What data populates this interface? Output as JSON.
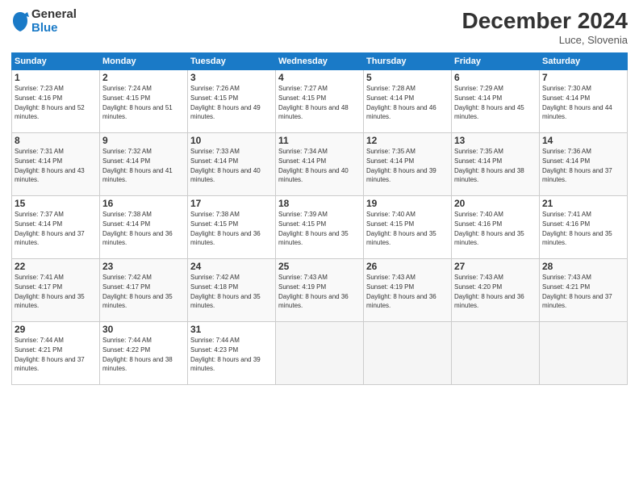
{
  "logo": {
    "general": "General",
    "blue": "Blue"
  },
  "title": "December 2024",
  "location": "Luce, Slovenia",
  "days_of_week": [
    "Sunday",
    "Monday",
    "Tuesday",
    "Wednesday",
    "Thursday",
    "Friday",
    "Saturday"
  ],
  "weeks": [
    [
      {
        "day": 1,
        "sunrise": "7:23 AM",
        "sunset": "4:16 PM",
        "daylight": "8 hours and 52 minutes."
      },
      {
        "day": 2,
        "sunrise": "7:24 AM",
        "sunset": "4:15 PM",
        "daylight": "8 hours and 51 minutes."
      },
      {
        "day": 3,
        "sunrise": "7:26 AM",
        "sunset": "4:15 PM",
        "daylight": "8 hours and 49 minutes."
      },
      {
        "day": 4,
        "sunrise": "7:27 AM",
        "sunset": "4:15 PM",
        "daylight": "8 hours and 48 minutes."
      },
      {
        "day": 5,
        "sunrise": "7:28 AM",
        "sunset": "4:14 PM",
        "daylight": "8 hours and 46 minutes."
      },
      {
        "day": 6,
        "sunrise": "7:29 AM",
        "sunset": "4:14 PM",
        "daylight": "8 hours and 45 minutes."
      },
      {
        "day": 7,
        "sunrise": "7:30 AM",
        "sunset": "4:14 PM",
        "daylight": "8 hours and 44 minutes."
      }
    ],
    [
      {
        "day": 8,
        "sunrise": "7:31 AM",
        "sunset": "4:14 PM",
        "daylight": "8 hours and 43 minutes."
      },
      {
        "day": 9,
        "sunrise": "7:32 AM",
        "sunset": "4:14 PM",
        "daylight": "8 hours and 41 minutes."
      },
      {
        "day": 10,
        "sunrise": "7:33 AM",
        "sunset": "4:14 PM",
        "daylight": "8 hours and 40 minutes."
      },
      {
        "day": 11,
        "sunrise": "7:34 AM",
        "sunset": "4:14 PM",
        "daylight": "8 hours and 40 minutes."
      },
      {
        "day": 12,
        "sunrise": "7:35 AM",
        "sunset": "4:14 PM",
        "daylight": "8 hours and 39 minutes."
      },
      {
        "day": 13,
        "sunrise": "7:35 AM",
        "sunset": "4:14 PM",
        "daylight": "8 hours and 38 minutes."
      },
      {
        "day": 14,
        "sunrise": "7:36 AM",
        "sunset": "4:14 PM",
        "daylight": "8 hours and 37 minutes."
      }
    ],
    [
      {
        "day": 15,
        "sunrise": "7:37 AM",
        "sunset": "4:14 PM",
        "daylight": "8 hours and 37 minutes."
      },
      {
        "day": 16,
        "sunrise": "7:38 AM",
        "sunset": "4:14 PM",
        "daylight": "8 hours and 36 minutes."
      },
      {
        "day": 17,
        "sunrise": "7:38 AM",
        "sunset": "4:15 PM",
        "daylight": "8 hours and 36 minutes."
      },
      {
        "day": 18,
        "sunrise": "7:39 AM",
        "sunset": "4:15 PM",
        "daylight": "8 hours and 35 minutes."
      },
      {
        "day": 19,
        "sunrise": "7:40 AM",
        "sunset": "4:15 PM",
        "daylight": "8 hours and 35 minutes."
      },
      {
        "day": 20,
        "sunrise": "7:40 AM",
        "sunset": "4:16 PM",
        "daylight": "8 hours and 35 minutes."
      },
      {
        "day": 21,
        "sunrise": "7:41 AM",
        "sunset": "4:16 PM",
        "daylight": "8 hours and 35 minutes."
      }
    ],
    [
      {
        "day": 22,
        "sunrise": "7:41 AM",
        "sunset": "4:17 PM",
        "daylight": "8 hours and 35 minutes."
      },
      {
        "day": 23,
        "sunrise": "7:42 AM",
        "sunset": "4:17 PM",
        "daylight": "8 hours and 35 minutes."
      },
      {
        "day": 24,
        "sunrise": "7:42 AM",
        "sunset": "4:18 PM",
        "daylight": "8 hours and 35 minutes."
      },
      {
        "day": 25,
        "sunrise": "7:43 AM",
        "sunset": "4:19 PM",
        "daylight": "8 hours and 36 minutes."
      },
      {
        "day": 26,
        "sunrise": "7:43 AM",
        "sunset": "4:19 PM",
        "daylight": "8 hours and 36 minutes."
      },
      {
        "day": 27,
        "sunrise": "7:43 AM",
        "sunset": "4:20 PM",
        "daylight": "8 hours and 36 minutes."
      },
      {
        "day": 28,
        "sunrise": "7:43 AM",
        "sunset": "4:21 PM",
        "daylight": "8 hours and 37 minutes."
      }
    ],
    [
      {
        "day": 29,
        "sunrise": "7:44 AM",
        "sunset": "4:21 PM",
        "daylight": "8 hours and 37 minutes."
      },
      {
        "day": 30,
        "sunrise": "7:44 AM",
        "sunset": "4:22 PM",
        "daylight": "8 hours and 38 minutes."
      },
      {
        "day": 31,
        "sunrise": "7:44 AM",
        "sunset": "4:23 PM",
        "daylight": "8 hours and 39 minutes."
      },
      null,
      null,
      null,
      null
    ]
  ]
}
